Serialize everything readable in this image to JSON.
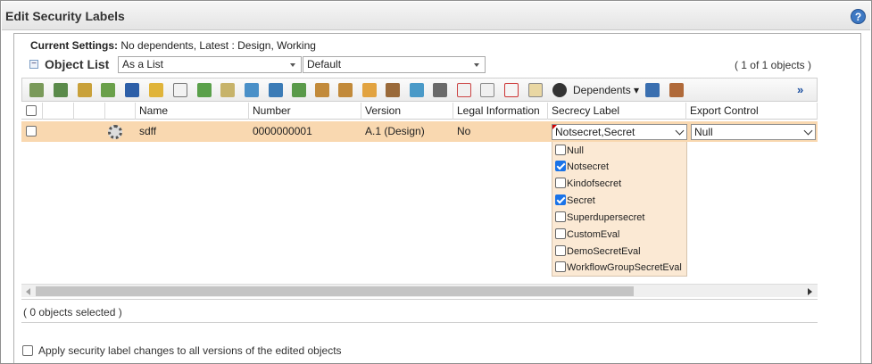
{
  "window": {
    "title": "Edit Security Labels",
    "help_icon": "help-icon"
  },
  "current_settings": {
    "label": "Current Settings:",
    "value": "No dependents, Latest : Design, Working"
  },
  "object_list": {
    "title": "Object List",
    "view_select": "As a List",
    "filter_select": "Default",
    "count": "( 1 of 1 objects )"
  },
  "toolbar": {
    "icons": [
      "action-icon",
      "add-icon",
      "insert-icon",
      "copy-icon",
      "edit-icon",
      "paste-icon",
      "new-doc-icon",
      "tag-icon",
      "table-icon",
      "refresh-icon",
      "view-icon",
      "move-icon",
      "tree-up-icon",
      "tree-down-icon",
      "folder-icon",
      "filter-icon",
      "reload-icon",
      "export-icon",
      "clear-icon",
      "columns-icon",
      "delete-icon",
      "new-window-icon",
      "sync-icon"
    ],
    "dependents_label": "Dependents",
    "more_label": "»"
  },
  "columns": [
    "Name",
    "Number",
    "Version",
    "Legal Information",
    "Secrecy Label",
    "Export Control"
  ],
  "rows": [
    {
      "name": "sdff",
      "number": "0000000001",
      "version": "A.1 (Design)",
      "legal": "No",
      "secrecy": "Notsecret,Secret",
      "export": "Null"
    }
  ],
  "secrecy_options": [
    {
      "label": "Null",
      "checked": false
    },
    {
      "label": "Notsecret",
      "checked": true
    },
    {
      "label": "Kindofsecret",
      "checked": false
    },
    {
      "label": "Secret",
      "checked": true
    },
    {
      "label": "Superdupersecret",
      "checked": false
    },
    {
      "label": "CustomEval",
      "checked": false
    },
    {
      "label": "DemoSecretEval",
      "checked": false
    },
    {
      "label": "WorkflowGroupSecretEval",
      "checked": false
    }
  ],
  "footer": {
    "selected_text": "( 0 objects selected )",
    "apply_label": "Apply security label changes to all versions of the edited objects"
  },
  "colors": {
    "row_highlight": "#f9d8b0",
    "dropdown_bg": "#fbe9d4",
    "accent": "#3d78c3"
  }
}
